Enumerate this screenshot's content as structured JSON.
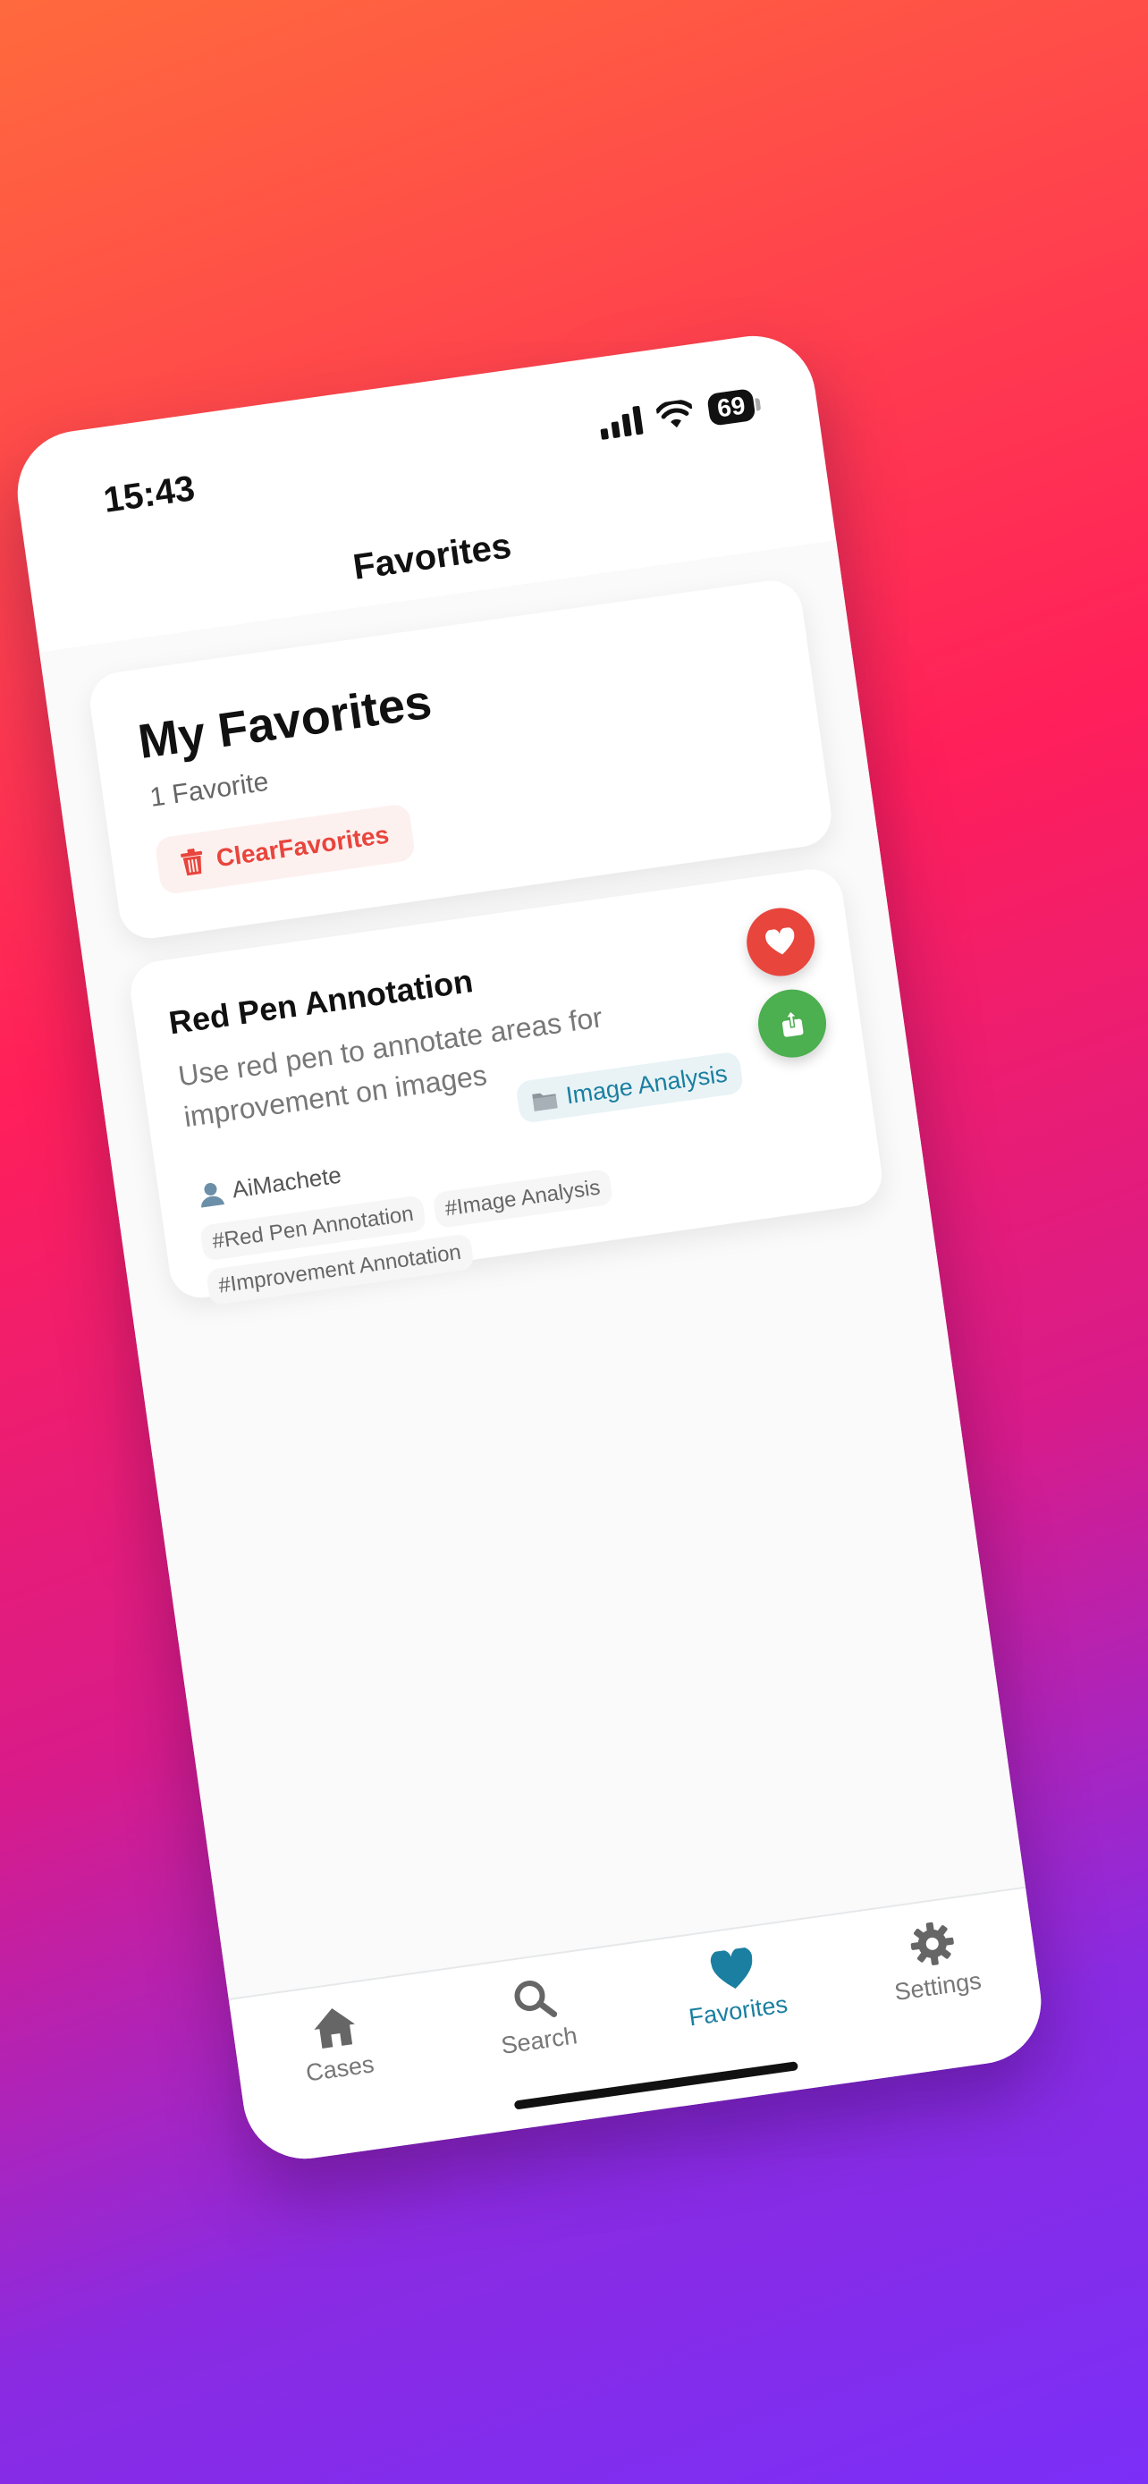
{
  "status_bar": {
    "time": "15:43",
    "battery": "69"
  },
  "header": {
    "title": "Favorites"
  },
  "summary": {
    "title": "My Favorites",
    "count_text": "1 Favorite",
    "clear_label": "ClearFavorites"
  },
  "favorites": [
    {
      "title": "Red Pen Annotation",
      "description": "Use red pen to annotate areas for improvement on images",
      "category": "Image Analysis",
      "author": "AiMachete",
      "tags": [
        "#Red Pen Annotation",
        "#Image Analysis",
        "#Improvement Annotation"
      ]
    }
  ],
  "tab_bar": {
    "items": [
      {
        "label": "Cases",
        "icon": "home-icon"
      },
      {
        "label": "Search",
        "icon": "search-icon"
      },
      {
        "label": "Favorites",
        "icon": "heart-icon"
      },
      {
        "label": "Settings",
        "icon": "gear-icon"
      }
    ],
    "active": "Favorites"
  },
  "colors": {
    "accent": "#1a7fa0",
    "danger": "#e8453c",
    "share": "#4caf50"
  }
}
